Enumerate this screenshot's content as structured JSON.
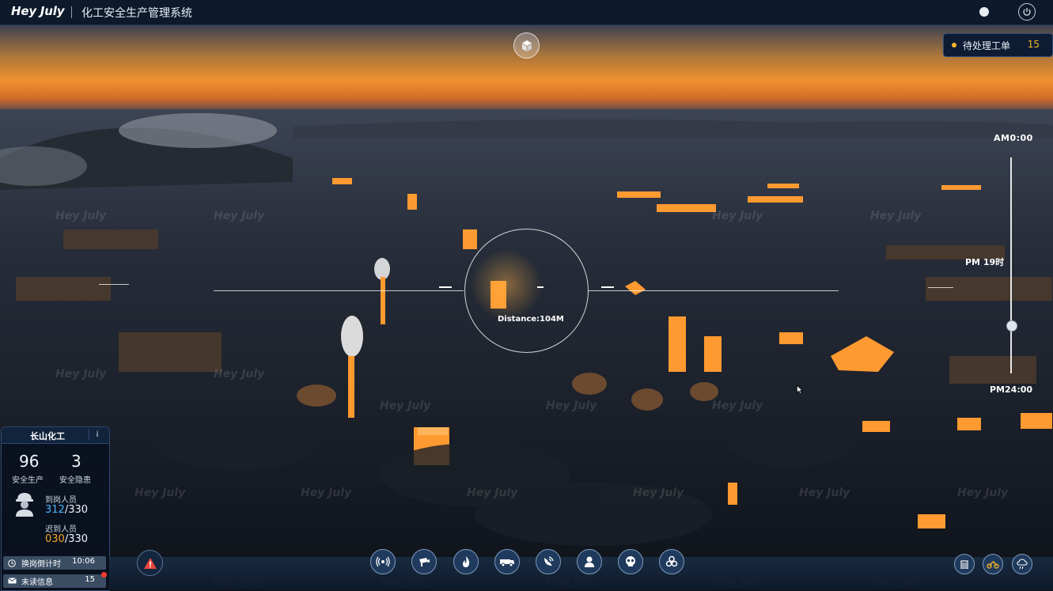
{
  "header": {
    "brand": "Hey July",
    "title": "化工安全生产管理系统"
  },
  "pending_orders": {
    "label": "待处理工单",
    "count": "15"
  },
  "time_slider": {
    "top_label": "AM0:00",
    "mid_label": "PM 19时",
    "bottom_label": "PM24:00",
    "position_fraction": 0.78
  },
  "reticle": {
    "distance_text": "Distance:104M"
  },
  "watermark_text": "Hey July",
  "site_panel": {
    "name": "长山化工",
    "info_label": "i",
    "safe_production": {
      "value": "96",
      "label": "安全生产"
    },
    "safety_hazards": {
      "value": "3",
      "label": "安全隐患"
    },
    "on_duty": {
      "label": "到岗人员",
      "count": "312",
      "total": "/330"
    },
    "late": {
      "label": "迟到人员",
      "count": "030",
      "total": "/330"
    },
    "shift_countdown": {
      "label": "换岗倒计时",
      "value": "10:06"
    },
    "unread_messages": {
      "label": "未读信息",
      "value": "15"
    }
  },
  "toolbar": {
    "center_icons": [
      "broadcast-icon",
      "camera-icon",
      "fire-icon",
      "vehicle-icon",
      "gas-detector-icon",
      "person-icon",
      "toxic-icon",
      "biohazard-icon"
    ],
    "right_icons": [
      "building-icon",
      "motorbike-icon",
      "cloud-rain-icon"
    ]
  },
  "colors": {
    "accent_orange": "#f5a623",
    "accent_blue": "#4db6ff",
    "alert_red": "#ff3b30",
    "panel_border": "#2d4a72"
  }
}
